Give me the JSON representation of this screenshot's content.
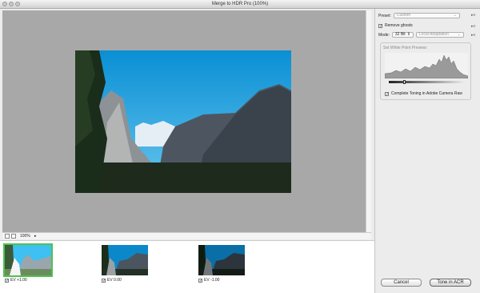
{
  "window": {
    "title": "Merge to HDR Pro (100%)"
  },
  "status": {
    "zoom": "100%"
  },
  "images": [
    {
      "label": "EV +1.00",
      "checked": true,
      "selected": true
    },
    {
      "label": "EV 0.00",
      "checked": true,
      "selected": false
    },
    {
      "label": "EV -1.00",
      "checked": true,
      "selected": false
    }
  ],
  "panel": {
    "preset_label": "Preset:",
    "preset_value": "Custom",
    "remove_ghosts_label": "Remove ghosts",
    "mode_label": "Mode:",
    "mode_value": "32 Bit",
    "method_value": "Local Adaptation",
    "white_point_label": "Set White Point Preview:",
    "complete_toning_label": "Complete Toning in Adobe Camera Raw",
    "white_point_level": 0.2
  },
  "buttons": {
    "cancel": "Cancel",
    "tone": "Tone in ACR"
  }
}
